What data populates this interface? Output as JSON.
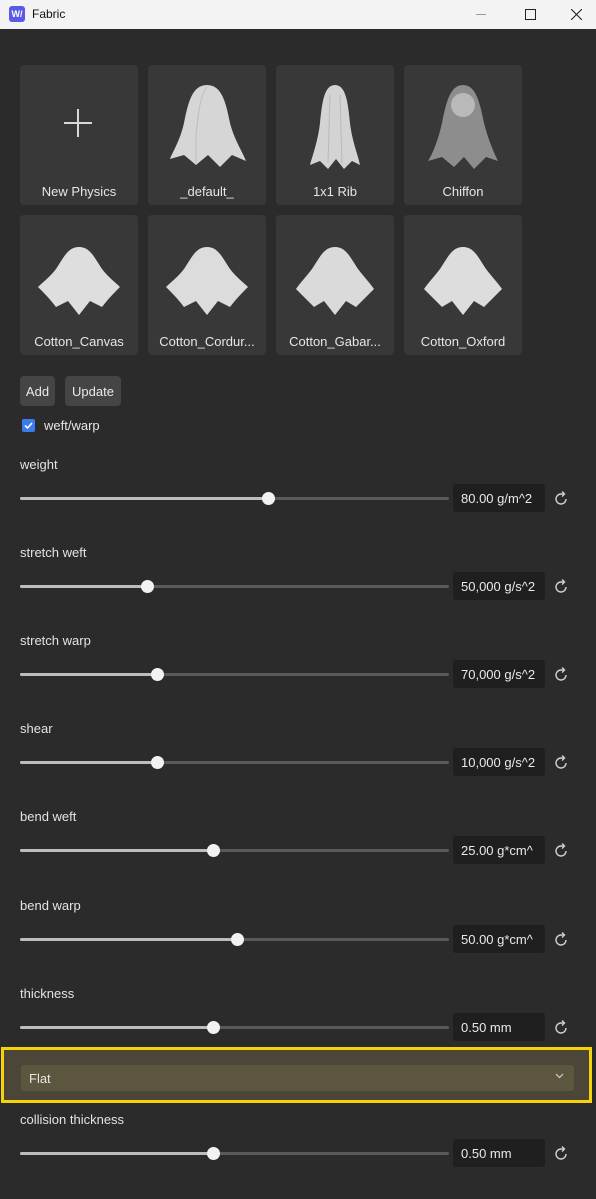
{
  "window": {
    "title": "Fabric",
    "app_icon": "W/",
    "minimize": "—",
    "maximize": "☐",
    "close": "✕"
  },
  "presets": [
    {
      "label": "New Physics",
      "icon": "plus-icon"
    },
    {
      "label": "_default_",
      "icon": "cloth-thumbnail"
    },
    {
      "label": "1x1 Rib",
      "icon": "cloth-thumbnail"
    },
    {
      "label": "Chiffon",
      "icon": "cloth-thumbnail"
    },
    {
      "label": "Cotton_Canvas",
      "icon": "cloth-thumbnail"
    },
    {
      "label": "Cotton_Cordur...",
      "icon": "cloth-thumbnail"
    },
    {
      "label": "Cotton_Gabar...",
      "icon": "cloth-thumbnail"
    },
    {
      "label": "Cotton_Oxford",
      "icon": "cloth-thumbnail"
    }
  ],
  "actions": {
    "add": "Add",
    "update": "Update"
  },
  "weft_warp": {
    "label": "weft/warp",
    "checked": true
  },
  "params": {
    "weight": {
      "label": "weight",
      "value": "80.00 g/m^2",
      "fraction": 0.578
    },
    "stretch_weft": {
      "label": "stretch weft",
      "value": "50,000 g/s^2",
      "fraction": 0.296
    },
    "stretch_warp": {
      "label": "stretch warp",
      "value": "70,000 g/s^2",
      "fraction": 0.319
    },
    "shear": {
      "label": "shear",
      "value": "10,000 g/s^2",
      "fraction": 0.319
    },
    "bend_weft": {
      "label": "bend weft",
      "value": "25.00 g*cm^",
      "fraction": 0.45
    },
    "bend_warp": {
      "label": "bend warp",
      "value": "50.00 g*cm^",
      "fraction": 0.506
    },
    "thickness": {
      "label": "thickness",
      "value": "0.50 mm",
      "fraction": 0.45
    },
    "collision_thickness": {
      "label": "collision thickness",
      "value": "0.50 mm",
      "fraction": 0.45
    }
  },
  "mode_dropdown": {
    "value": "Flat"
  },
  "colors": {
    "accent": "#3b7bf0",
    "highlight": "#f5d20a",
    "background": "#2b2b2b"
  }
}
